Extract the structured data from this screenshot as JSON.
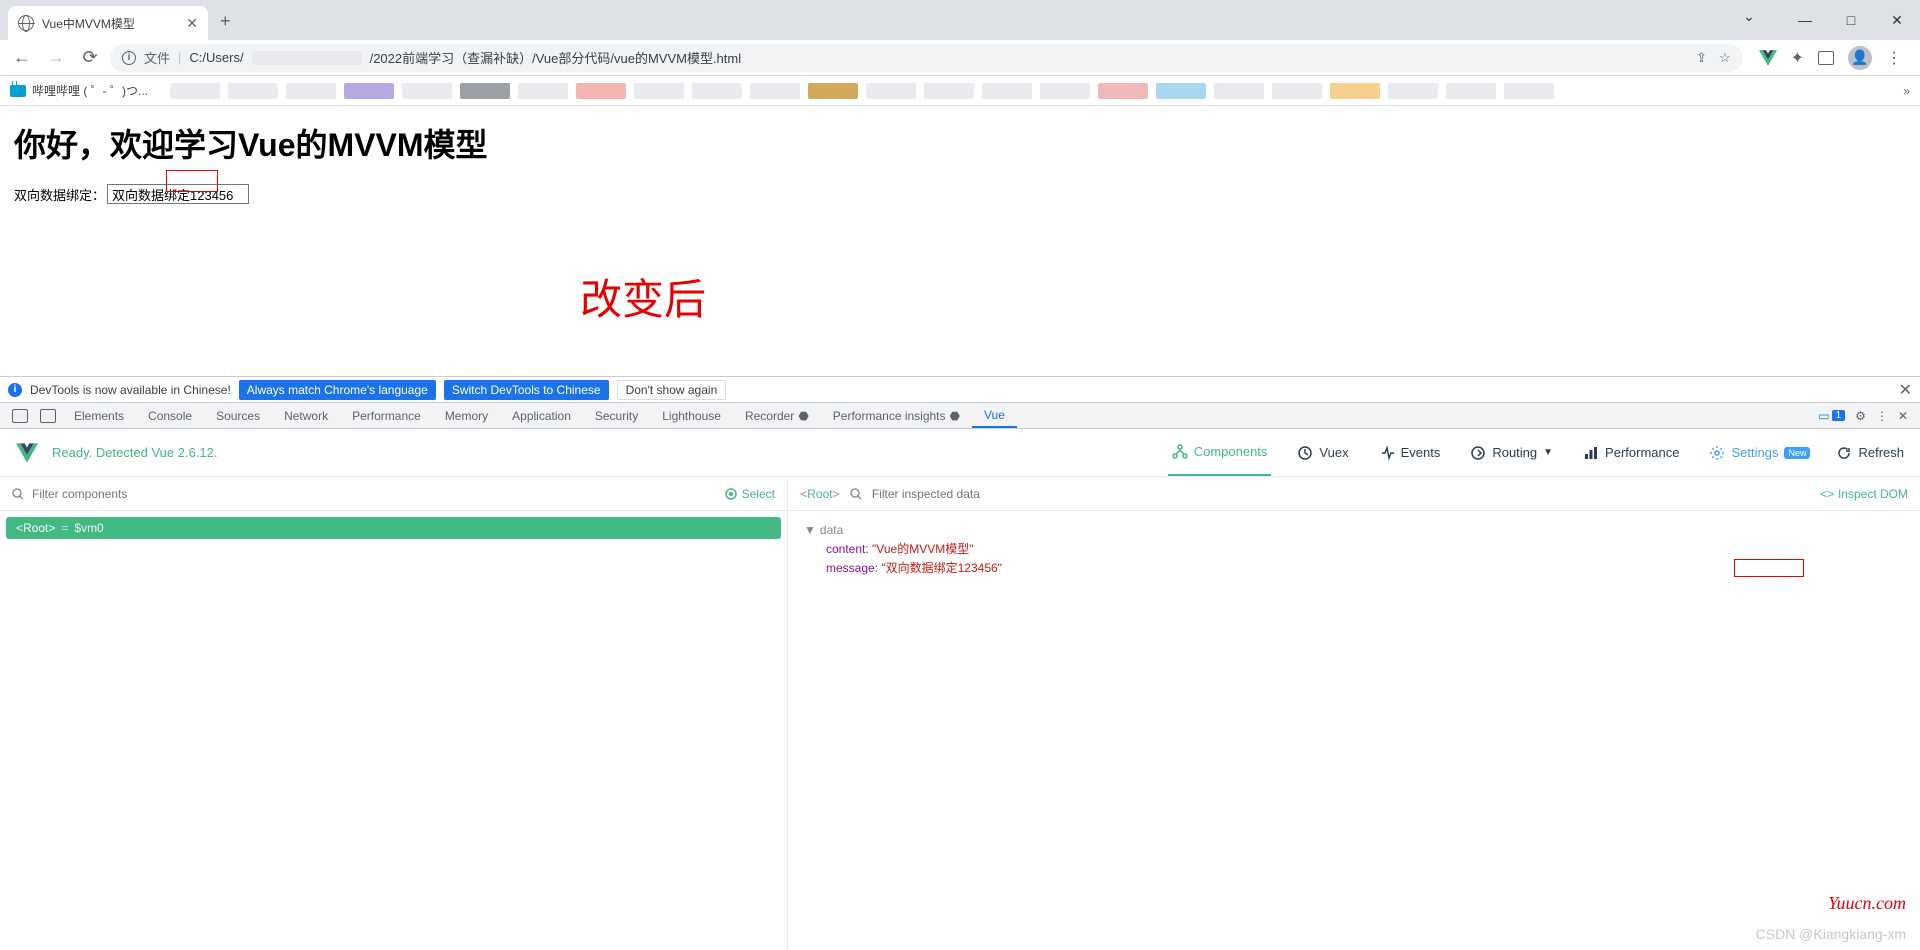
{
  "browser": {
    "tab_title": "Vue中MVVM模型",
    "address_prefix": "文件",
    "address_path_visible_left": "C:/Users/",
    "address_path_visible_right": "/2022前端学习（查漏补缺）/Vue部分代码/vue的MVVM模型.html",
    "bookmark_label": "哔哩哔哩 (  ゜- ゜)つ..."
  },
  "window_controls": {
    "min": "—",
    "max": "□",
    "close": "✕"
  },
  "page": {
    "heading": "你好，欢迎学习Vue的MVVM模型",
    "binding_label": "双向数据绑定：",
    "input_value": "双向数据绑定123456",
    "annotation": "改变后"
  },
  "devtools": {
    "banner": {
      "message": "DevTools is now available in Chinese!",
      "btn_match": "Always match Chrome's language",
      "btn_switch": "Switch DevTools to Chinese",
      "btn_dont": "Don't show again"
    },
    "tabs": [
      "Elements",
      "Console",
      "Sources",
      "Network",
      "Performance",
      "Memory",
      "Application",
      "Security",
      "Lighthouse",
      "Recorder",
      "Performance insights",
      "Vue"
    ],
    "active_tab": "Vue",
    "issues_count": "1"
  },
  "vue_panel": {
    "status": "Ready. Detected Vue 2.6.12.",
    "tabs": {
      "components": "Components",
      "vuex": "Vuex",
      "events": "Events",
      "routing": "Routing",
      "performance": "Performance",
      "settings": "Settings",
      "settings_badge": "New",
      "refresh": "Refresh"
    },
    "filter_placeholder": "Filter components",
    "select_label": "Select",
    "tree_root": "<Root>",
    "tree_vm": "$vm0",
    "right": {
      "root_label": "Root",
      "filter_placeholder": "Filter inspected data",
      "inspect_dom": "Inspect DOM",
      "section": "data",
      "props": {
        "content_key": "content:",
        "content_val": "\"Vue的MVVM模型\"",
        "message_key": "message:",
        "message_val": "\"双向数据绑定123456\""
      }
    }
  },
  "watermarks": {
    "w1": "Yuucn.com",
    "w2": "CSDN @Kiangkiang-xm"
  }
}
